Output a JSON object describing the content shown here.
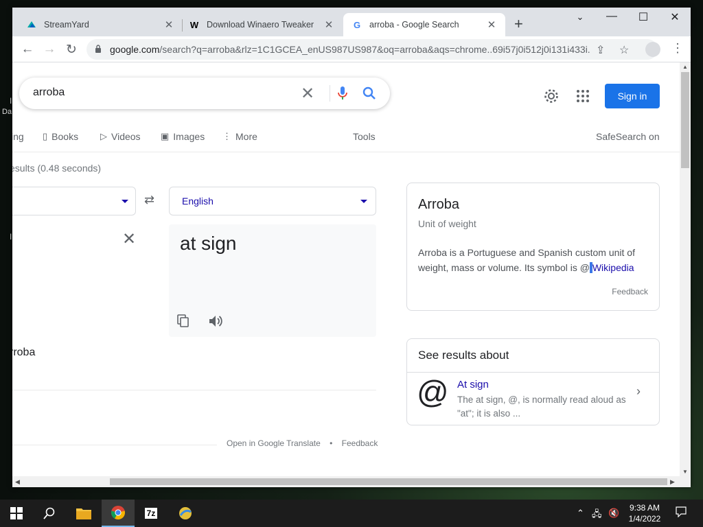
{
  "desktop": {
    "frag1": "I",
    "frag2": "Da",
    "frag3": "I"
  },
  "browser": {
    "tabs": [
      {
        "title": "StreamYard",
        "favicon": "streamyard-icon"
      },
      {
        "title": "Download Winaero Tweaker",
        "favicon": "winaero-icon",
        "favicon_text": "W"
      },
      {
        "title": "arroba - Google Search",
        "favicon": "google-icon",
        "favicon_text": "G"
      }
    ],
    "url_host": "google.com",
    "url_rest": "/search?q=arroba&rlz=1C1GCEA_enUS987US987&oq=arroba&aqs=chrome..69i57j0i512j0i131i433i..."
  },
  "search": {
    "query": "arroba",
    "sign_in": "Sign in",
    "tabs": [
      "ing",
      "Books",
      "Videos",
      "Images",
      "More"
    ],
    "tools": "Tools",
    "safesearch": "SafeSearch on",
    "stats": "esults (0.48 seconds)"
  },
  "translate": {
    "target_lang": "English",
    "result": "at sign",
    "source_fragment": "rroba",
    "open_link": "Open in Google Translate",
    "dot": "•",
    "feedback": "Feedback"
  },
  "knowledge_panel": {
    "title": "Arroba",
    "subtitle": "Unit of weight",
    "desc_before": "Arroba is a Portuguese and Spanish custom unit of weight, mass or volume. Its symbol is @",
    "desc_selected": " ",
    "desc_link": "Wikipedia",
    "feedback": "Feedback"
  },
  "see_results": {
    "heading": "See results about",
    "symbol": "@",
    "title": "At sign",
    "desc": "The at sign, @, is normally read aloud as \"at\"; it is also ..."
  },
  "taskbar": {
    "time": "9:38 AM",
    "date": "1/4/2022",
    "sevenzip": "7z"
  },
  "colors": {
    "accent": "#1a73e8",
    "link": "#1a0dab"
  }
}
